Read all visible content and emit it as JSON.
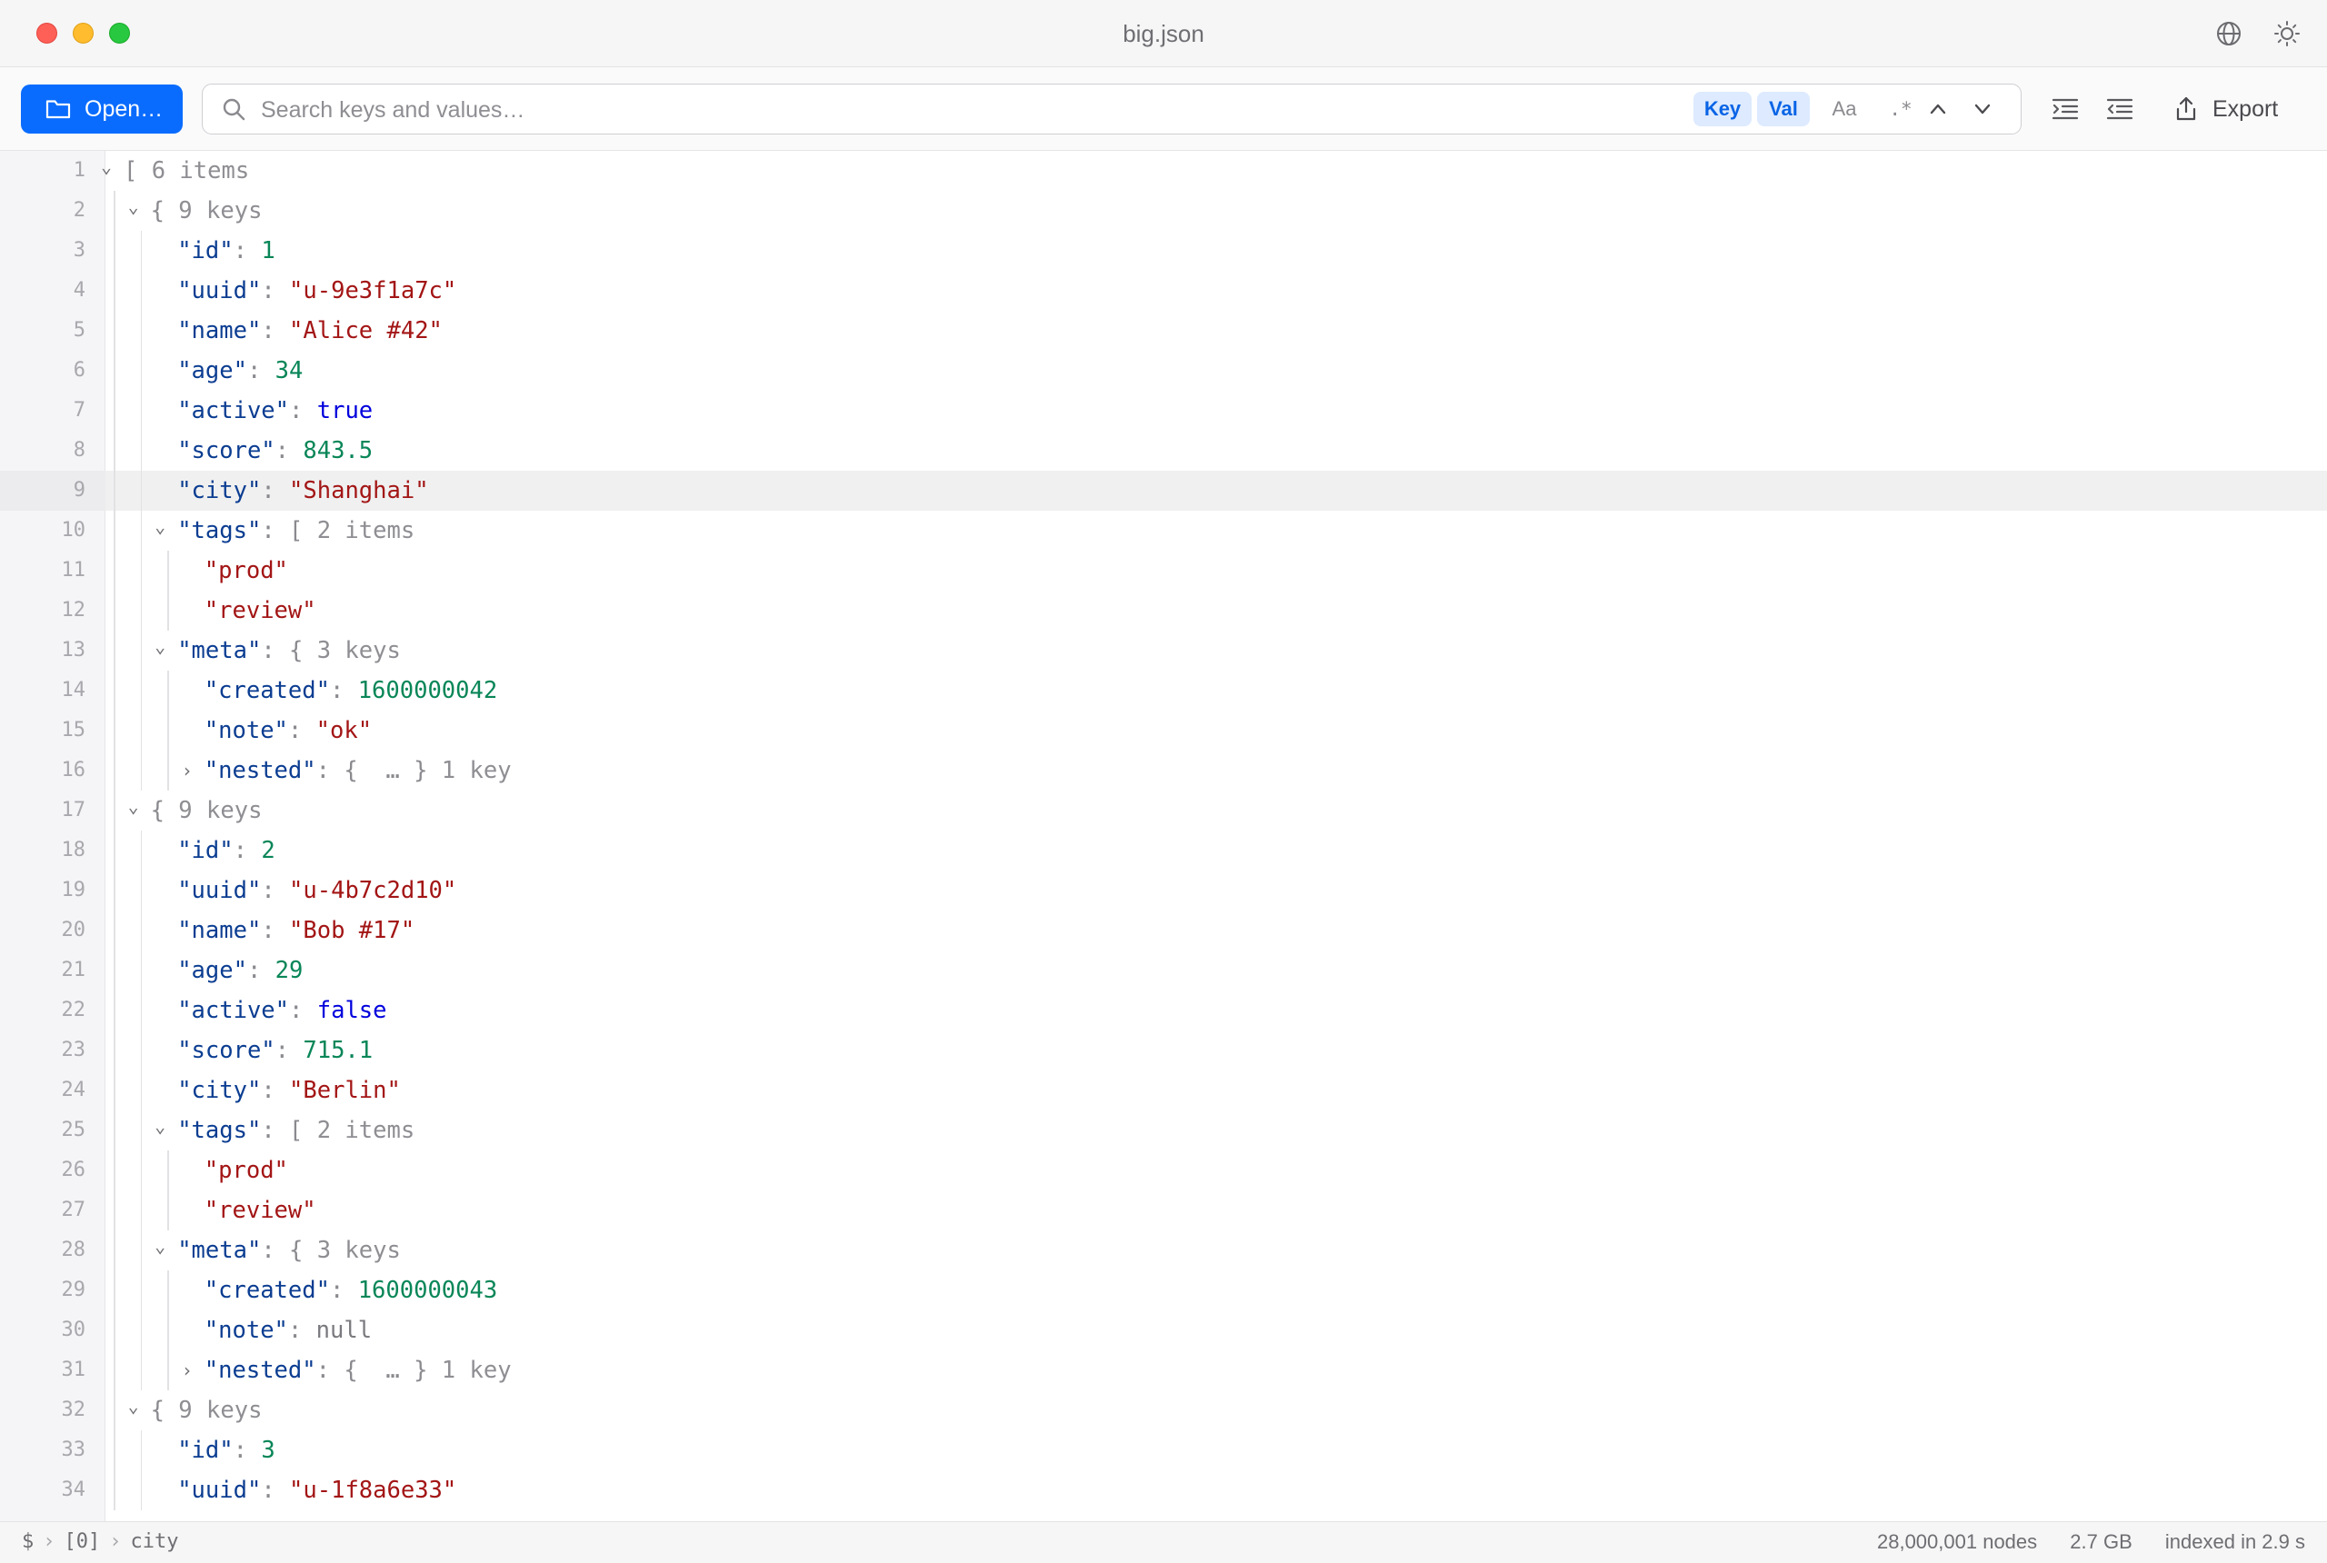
{
  "window": {
    "title": "big.json"
  },
  "toolbar": {
    "open_label": "Open…",
    "search_placeholder": "Search keys and values…",
    "search_value": "",
    "chip_key": "Key",
    "chip_val": "Val",
    "chip_case": "Aa",
    "chip_regex": ".*",
    "export_label": "Export"
  },
  "editor": {
    "selected_line": 9,
    "lines": [
      {
        "n": "1",
        "d": 0,
        "c": "open",
        "t": [
          [
            "[",
            "p"
          ],
          [
            " 6 items",
            "m"
          ]
        ]
      },
      {
        "n": "2",
        "d": 1,
        "c": "open",
        "t": [
          [
            "{",
            "p"
          ],
          [
            " 9 keys",
            "m"
          ]
        ]
      },
      {
        "n": "3",
        "d": 2,
        "c": "",
        "t": [
          [
            "\"id\"",
            "k"
          ],
          [
            ": ",
            "p"
          ],
          [
            "1",
            "n"
          ]
        ]
      },
      {
        "n": "4",
        "d": 2,
        "c": "",
        "t": [
          [
            "\"uuid\"",
            "k"
          ],
          [
            ": ",
            "p"
          ],
          [
            "\"u-9e3f1a7c\"",
            "s"
          ]
        ]
      },
      {
        "n": "5",
        "d": 2,
        "c": "",
        "t": [
          [
            "\"name\"",
            "k"
          ],
          [
            ": ",
            "p"
          ],
          [
            "\"Alice #42\"",
            "s"
          ]
        ]
      },
      {
        "n": "6",
        "d": 2,
        "c": "",
        "t": [
          [
            "\"age\"",
            "k"
          ],
          [
            ": ",
            "p"
          ],
          [
            "34",
            "n"
          ]
        ]
      },
      {
        "n": "7",
        "d": 2,
        "c": "",
        "t": [
          [
            "\"active\"",
            "k"
          ],
          [
            ": ",
            "p"
          ],
          [
            "true",
            "b"
          ]
        ]
      },
      {
        "n": "8",
        "d": 2,
        "c": "",
        "t": [
          [
            "\"score\"",
            "k"
          ],
          [
            ": ",
            "p"
          ],
          [
            "843.5",
            "n"
          ]
        ]
      },
      {
        "n": "9",
        "d": 2,
        "c": "",
        "t": [
          [
            "\"city\"",
            "k"
          ],
          [
            ": ",
            "p"
          ],
          [
            "\"Shanghai\"",
            "s"
          ]
        ]
      },
      {
        "n": "10",
        "d": 2,
        "c": "open",
        "t": [
          [
            "\"tags\"",
            "k"
          ],
          [
            ": [",
            "p"
          ],
          [
            " 2 items",
            "m"
          ]
        ]
      },
      {
        "n": "11",
        "d": 3,
        "c": "",
        "t": [
          [
            "\"prod\"",
            "s"
          ]
        ]
      },
      {
        "n": "12",
        "d": 3,
        "c": "",
        "t": [
          [
            "\"review\"",
            "s"
          ]
        ]
      },
      {
        "n": "13",
        "d": 2,
        "c": "open",
        "t": [
          [
            "\"meta\"",
            "k"
          ],
          [
            ": {",
            "p"
          ],
          [
            " 3 keys",
            "m"
          ]
        ]
      },
      {
        "n": "14",
        "d": 3,
        "c": "",
        "t": [
          [
            "\"created\"",
            "k"
          ],
          [
            ": ",
            "p"
          ],
          [
            "1600000042",
            "n"
          ]
        ]
      },
      {
        "n": "15",
        "d": 3,
        "c": "",
        "t": [
          [
            "\"note\"",
            "k"
          ],
          [
            ": ",
            "p"
          ],
          [
            "\"ok\"",
            "s"
          ]
        ]
      },
      {
        "n": "16",
        "d": 3,
        "c": "closed",
        "t": [
          [
            "\"nested\"",
            "k"
          ],
          [
            ": {  … }",
            "p"
          ],
          [
            " 1 key",
            "m"
          ]
        ]
      },
      {
        "n": "17",
        "d": 1,
        "c": "open",
        "t": [
          [
            "{",
            "p"
          ],
          [
            " 9 keys",
            "m"
          ]
        ]
      },
      {
        "n": "18",
        "d": 2,
        "c": "",
        "t": [
          [
            "\"id\"",
            "k"
          ],
          [
            ": ",
            "p"
          ],
          [
            "2",
            "n"
          ]
        ]
      },
      {
        "n": "19",
        "d": 2,
        "c": "",
        "t": [
          [
            "\"uuid\"",
            "k"
          ],
          [
            ": ",
            "p"
          ],
          [
            "\"u-4b7c2d10\"",
            "s"
          ]
        ]
      },
      {
        "n": "20",
        "d": 2,
        "c": "",
        "t": [
          [
            "\"name\"",
            "k"
          ],
          [
            ": ",
            "p"
          ],
          [
            "\"Bob #17\"",
            "s"
          ]
        ]
      },
      {
        "n": "21",
        "d": 2,
        "c": "",
        "t": [
          [
            "\"age\"",
            "k"
          ],
          [
            ": ",
            "p"
          ],
          [
            "29",
            "n"
          ]
        ]
      },
      {
        "n": "22",
        "d": 2,
        "c": "",
        "t": [
          [
            "\"active\"",
            "k"
          ],
          [
            ": ",
            "p"
          ],
          [
            "false",
            "b"
          ]
        ]
      },
      {
        "n": "23",
        "d": 2,
        "c": "",
        "t": [
          [
            "\"score\"",
            "k"
          ],
          [
            ": ",
            "p"
          ],
          [
            "715.1",
            "n"
          ]
        ]
      },
      {
        "n": "24",
        "d": 2,
        "c": "",
        "t": [
          [
            "\"city\"",
            "k"
          ],
          [
            ": ",
            "p"
          ],
          [
            "\"Berlin\"",
            "s"
          ]
        ]
      },
      {
        "n": "25",
        "d": 2,
        "c": "open",
        "t": [
          [
            "\"tags\"",
            "k"
          ],
          [
            ": [",
            "p"
          ],
          [
            " 2 items",
            "m"
          ]
        ]
      },
      {
        "n": "26",
        "d": 3,
        "c": "",
        "t": [
          [
            "\"prod\"",
            "s"
          ]
        ]
      },
      {
        "n": "27",
        "d": 3,
        "c": "",
        "t": [
          [
            "\"review\"",
            "s"
          ]
        ]
      },
      {
        "n": "28",
        "d": 2,
        "c": "open",
        "t": [
          [
            "\"meta\"",
            "k"
          ],
          [
            ": {",
            "p"
          ],
          [
            " 3 keys",
            "m"
          ]
        ]
      },
      {
        "n": "29",
        "d": 3,
        "c": "",
        "t": [
          [
            "\"created\"",
            "k"
          ],
          [
            ": ",
            "p"
          ],
          [
            "1600000043",
            "n"
          ]
        ]
      },
      {
        "n": "30",
        "d": 3,
        "c": "",
        "t": [
          [
            "\"note\"",
            "k"
          ],
          [
            ": ",
            "p"
          ],
          [
            "null",
            "nl"
          ]
        ]
      },
      {
        "n": "31",
        "d": 3,
        "c": "closed",
        "t": [
          [
            "\"nested\"",
            "k"
          ],
          [
            ": {  … }",
            "p"
          ],
          [
            " 1 key",
            "m"
          ]
        ]
      },
      {
        "n": "32",
        "d": 1,
        "c": "open",
        "t": [
          [
            "{",
            "p"
          ],
          [
            " 9 keys",
            "m"
          ]
        ]
      },
      {
        "n": "33",
        "d": 2,
        "c": "",
        "t": [
          [
            "\"id\"",
            "k"
          ],
          [
            ": ",
            "p"
          ],
          [
            "3",
            "n"
          ]
        ]
      },
      {
        "n": "34",
        "d": 2,
        "c": "",
        "t": [
          [
            "\"uuid\"",
            "k"
          ],
          [
            ": ",
            "p"
          ],
          [
            "\"u-1f8a6e33\"",
            "s"
          ]
        ]
      }
    ]
  },
  "statusbar": {
    "path": [
      "$",
      "[0]",
      "city"
    ],
    "nodes": "28,000,001 nodes",
    "size": "2.7 GB",
    "indexed": "indexed in 2.9 s"
  },
  "colors": {
    "accent": "#0a6cff",
    "key": "#0b3d91",
    "string": "#a31515",
    "number": "#098658",
    "boolean": "#0000dd"
  }
}
